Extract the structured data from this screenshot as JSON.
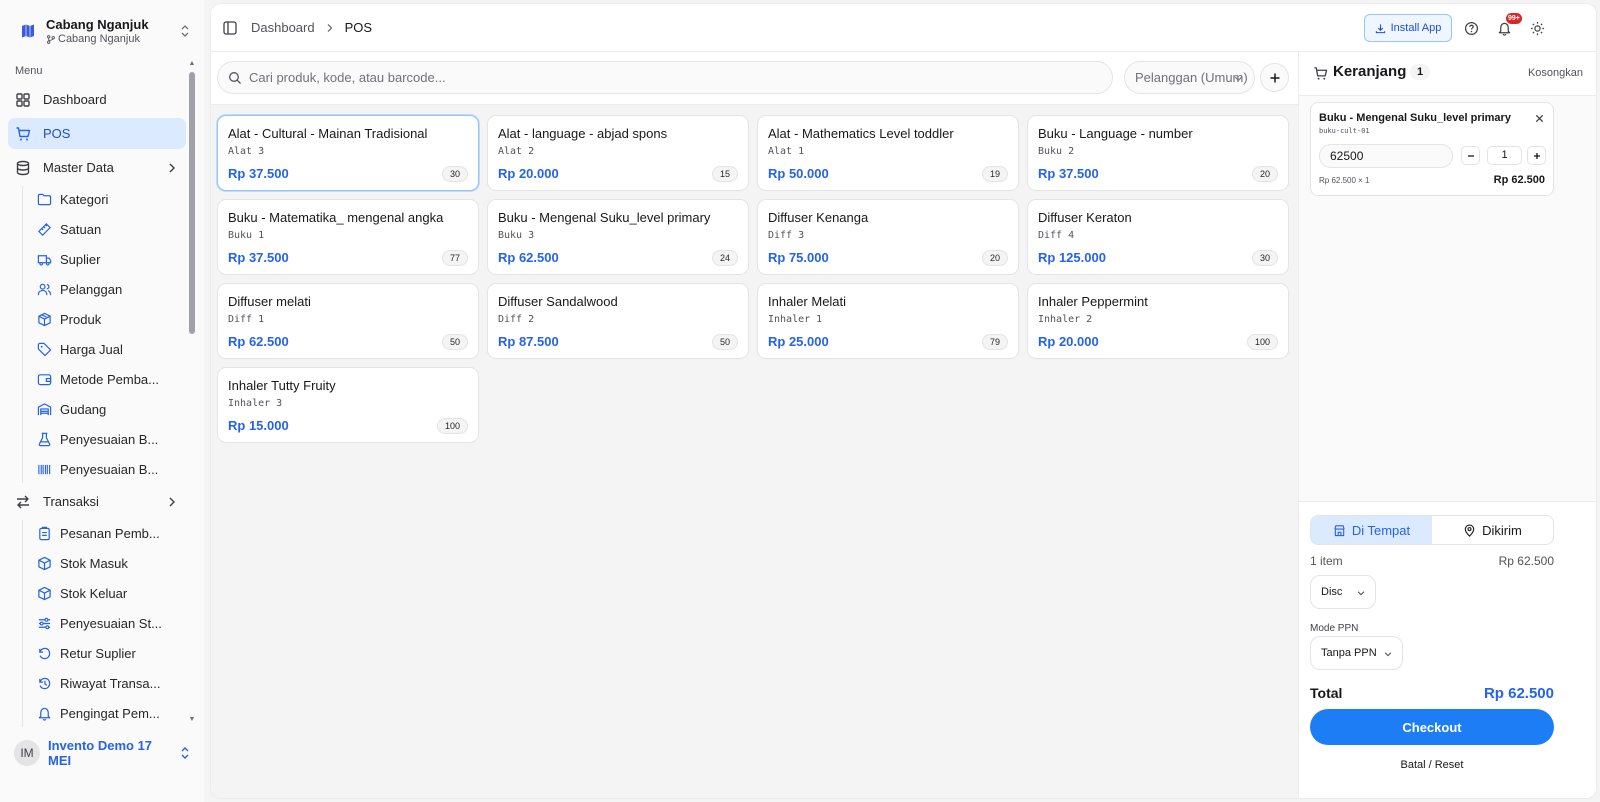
{
  "sidebar": {
    "brand": {
      "name": "Cabang Nganjuk",
      "branch": "Cabang Nganjuk"
    },
    "menu_label": "Menu",
    "items": [
      {
        "label": "Dashboard",
        "icon": "grid-icon"
      },
      {
        "label": "POS",
        "icon": "cart-icon",
        "active": true
      },
      {
        "label": "Master Data",
        "icon": "database-icon"
      }
    ],
    "master_data": [
      {
        "label": "Kategori",
        "icon": "folder-icon"
      },
      {
        "label": "Satuan",
        "icon": "ruler-icon"
      },
      {
        "label": "Suplier",
        "icon": "truck-icon"
      },
      {
        "label": "Pelanggan",
        "icon": "users-icon"
      },
      {
        "label": "Produk",
        "icon": "box-icon"
      },
      {
        "label": "Harga Jual",
        "icon": "tag-icon"
      },
      {
        "label": "Metode Pemba...",
        "icon": "wallet-icon"
      },
      {
        "label": "Gudang",
        "icon": "warehouse-icon"
      },
      {
        "label": "Penyesuaian B...",
        "icon": "flask-icon"
      },
      {
        "label": "Penyesuaian B...",
        "icon": "barcode-icon"
      }
    ],
    "transaksi_label": "Transaksi",
    "transaksi": [
      {
        "label": "Pesanan Pemb...",
        "icon": "clipboard-icon"
      },
      {
        "label": "Stok Masuk",
        "icon": "package-in-icon"
      },
      {
        "label": "Stok Keluar",
        "icon": "package-out-icon"
      },
      {
        "label": "Penyesuaian St...",
        "icon": "sliders-icon"
      },
      {
        "label": "Retur Suplier",
        "icon": "rotate-icon"
      },
      {
        "label": "Riwayat Transa...",
        "icon": "history-icon"
      },
      {
        "label": "Pengingat Pem...",
        "icon": "bell-icon"
      }
    ],
    "user": {
      "initials": "IM",
      "name": "Invento Demo 17 MEI"
    }
  },
  "header": {
    "breadcrumb": [
      "Dashboard",
      "POS"
    ],
    "install_label": "Install App",
    "notification_badge": "99+"
  },
  "search": {
    "placeholder": "Cari produk, kode, atau barcode..."
  },
  "customer_select": {
    "placeholder": "Pelanggan (Umum)"
  },
  "products": [
    {
      "name": "Alat - Cultural - Mainan Tradisional",
      "code": "Alat 3",
      "price": "Rp 37.500",
      "stock": "30"
    },
    {
      "name": "Alat - language - abjad spons",
      "code": "Alat 2",
      "price": "Rp 20.000",
      "stock": "15"
    },
    {
      "name": "Alat - Mathematics Level toddler",
      "code": "Alat 1",
      "price": "Rp 50.000",
      "stock": "19"
    },
    {
      "name": "Buku - Language - number",
      "code": "Buku 2",
      "price": "Rp 37.500",
      "stock": "20"
    },
    {
      "name": "Buku - Matematika_ mengenal angka",
      "code": "Buku 1",
      "price": "Rp 37.500",
      "stock": "77"
    },
    {
      "name": "Buku - Mengenal Suku_level primary",
      "code": "Buku 3",
      "price": "Rp 62.500",
      "stock": "24"
    },
    {
      "name": "Diffuser Kenanga",
      "code": "Diff 3",
      "price": "Rp 75.000",
      "stock": "20"
    },
    {
      "name": "Diffuser Keraton",
      "code": "Diff 4",
      "price": "Rp 125.000",
      "stock": "30"
    },
    {
      "name": "Diffuser melati",
      "code": "Diff 1",
      "price": "Rp 62.500",
      "stock": "50"
    },
    {
      "name": "Diffuser Sandalwood",
      "code": "Diff 2",
      "price": "Rp 87.500",
      "stock": "50"
    },
    {
      "name": "Inhaler Melati",
      "code": "Inhaler 1",
      "price": "Rp 25.000",
      "stock": "79"
    },
    {
      "name": "Inhaler Peppermint",
      "code": "Inhaler 2",
      "price": "Rp 20.000",
      "stock": "100"
    },
    {
      "name": "Inhaler Tutty Fruity",
      "code": "Inhaler 3",
      "price": "Rp 15.000",
      "stock": "100"
    }
  ],
  "cart": {
    "title": "Keranjang",
    "count": "1",
    "clear_label": "Kosongkan",
    "item": {
      "name": "Buku - Mengenal Suku_level primary",
      "code": "buku-cult-01",
      "price_input": "62500",
      "qty": "1",
      "subline": "Rp 62.500 × 1",
      "line_total": "Rp 62.500"
    },
    "modes": [
      "Di Tempat",
      "Dikirim"
    ],
    "items_count": "1 item",
    "items_total": "Rp 62.500",
    "disc_label": "Disc",
    "ppn_label": "Mode PPN",
    "ppn_value": "Tanpa PPN",
    "total_label": "Total",
    "total_value": "Rp 62.500",
    "checkout_label": "Checkout",
    "reset_label": "Batal / Reset"
  },
  "colors": {
    "accent": "#2563eb",
    "active_bg": "#dbeafe",
    "checkout": "#1d7df5",
    "badge": "#dc2626"
  }
}
